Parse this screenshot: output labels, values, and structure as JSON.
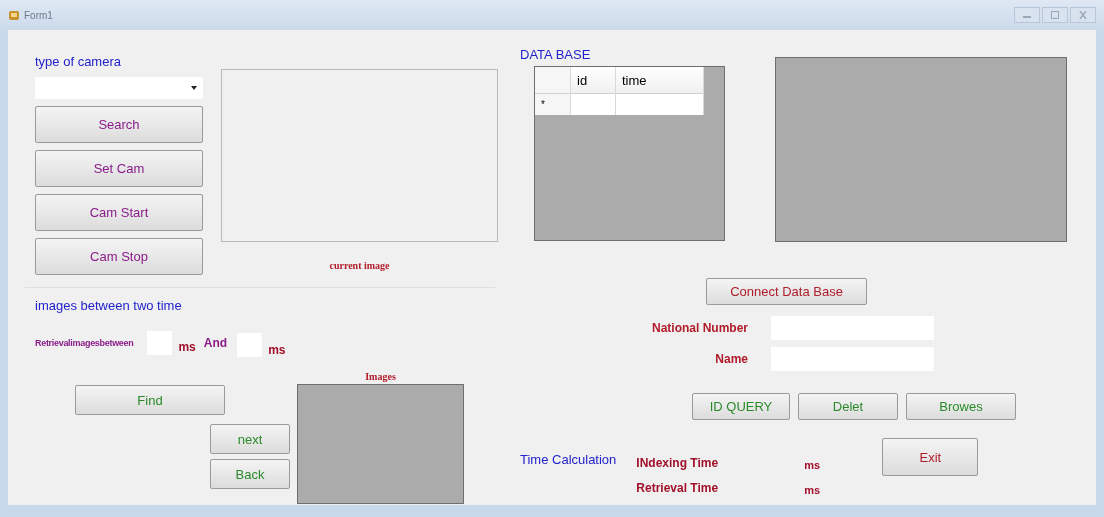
{
  "window": {
    "title": "Form1"
  },
  "camera": {
    "label": "type of camera",
    "buttons": [
      "Search",
      "Set Cam",
      "Cam Start",
      "Cam Stop"
    ],
    "image_caption": "current image"
  },
  "range": {
    "title": "images between two time",
    "label": "Retrievalimagesbetween",
    "unit_1": "ms",
    "and": "And",
    "unit_2": "ms",
    "find": "Find",
    "images_caption": "Images",
    "next": "next",
    "back": "Back"
  },
  "database": {
    "title": "DATA BASE",
    "columns": [
      "id",
      "time"
    ],
    "new_row_marker": "*",
    "connect": "Connect Data Base",
    "fields": [
      {
        "label": "National Number"
      },
      {
        "label": "Name"
      }
    ],
    "buttons": [
      "ID QUERY",
      "Delet",
      "Browes"
    ]
  },
  "timing": {
    "title": "Time Calculation",
    "rows": [
      {
        "label": "INdexing Time",
        "unit": "ms"
      },
      {
        "label": "Retrieval Time",
        "unit": "ms"
      }
    ],
    "exit": "Exit"
  }
}
